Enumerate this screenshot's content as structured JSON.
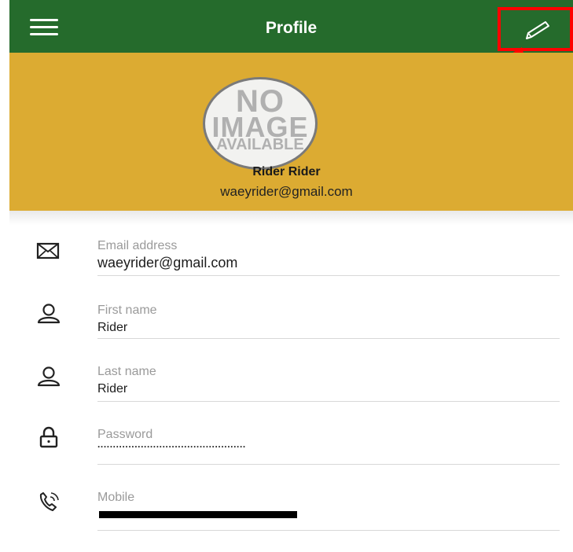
{
  "header": {
    "title": "Profile",
    "bar_color": "#256b2c",
    "menu_icon": "hamburger-menu-icon",
    "edit_icon": "pencil-icon"
  },
  "profile": {
    "avatar_lines": [
      "NO",
      "IMAGE",
      "AVAILABLE"
    ],
    "name": "Rider Rider",
    "email": "waeyrider@gmail.com",
    "banner_color": "#dcab32"
  },
  "fields": [
    {
      "icon": "envelope-icon",
      "label": "Email address",
      "value": "waeyrider@gmail.com"
    },
    {
      "icon": "person-icon",
      "label": "First name",
      "value": "Rider"
    },
    {
      "icon": "person-icon",
      "label": "Last name",
      "value": "Rider"
    },
    {
      "icon": "lock-icon",
      "label": "Password",
      "value": "................................................"
    },
    {
      "icon": "phone-icon",
      "label": "Mobile",
      "value": "",
      "value_redacted": true
    }
  ],
  "annotation": {
    "highlight_color": "#ff0000",
    "arrow_icon": "red-arrow-icon"
  }
}
